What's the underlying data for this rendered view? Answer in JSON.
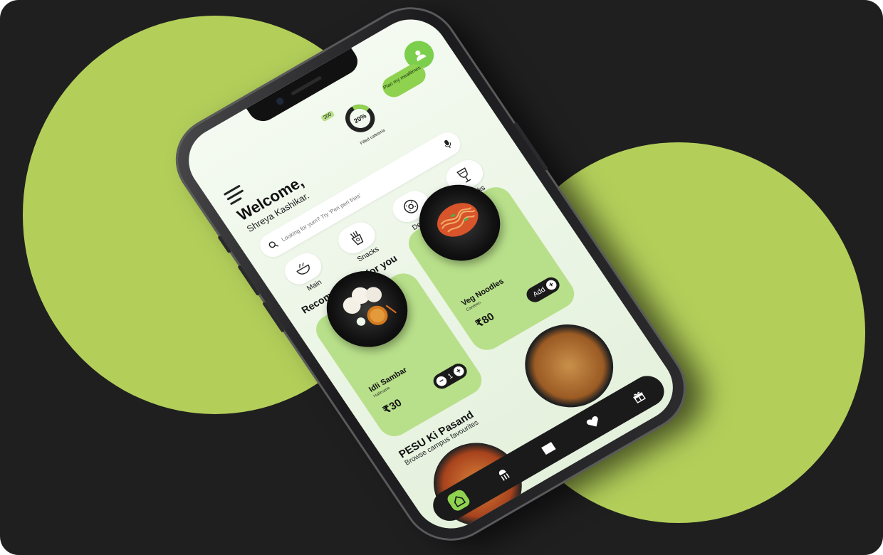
{
  "header": {
    "capacity_count": "200",
    "capacity_percent": "20%",
    "capacity_label": "Filled cafeteria",
    "plan_button": "Plan my mealtimes"
  },
  "welcome": {
    "title": "Welcome,",
    "name": "Shreya Kashikar."
  },
  "search": {
    "placeholder": "Looking for yum? Try 'Peri peri fries'"
  },
  "categories": [
    {
      "label": "Main",
      "icon": "bowl-icon"
    },
    {
      "label": "Snacks",
      "icon": "fries-icon"
    },
    {
      "label": "Desert",
      "icon": "donut-icon"
    },
    {
      "label": "Drinks",
      "icon": "glass-icon"
    }
  ],
  "recommended": {
    "title": "Recommended for you",
    "items": [
      {
        "name": "Idli Sambar",
        "place": "Halimane",
        "price": "₹30",
        "qty": "1"
      },
      {
        "name": "Veg Noodles",
        "place": "Canteen",
        "price": "₹80",
        "action": "Add"
      }
    ]
  },
  "pesu": {
    "title": "PESU Ki Pasand",
    "subtitle": "Browse campus favourites"
  },
  "nav": [
    "home-icon",
    "dining-icon",
    "ticket-icon",
    "heart-icon",
    "gift-icon"
  ],
  "colors": {
    "accent": "#8fd24f",
    "card": "#b8e08a",
    "background": "#1f1f1f",
    "blob": "#b3cf5a"
  }
}
